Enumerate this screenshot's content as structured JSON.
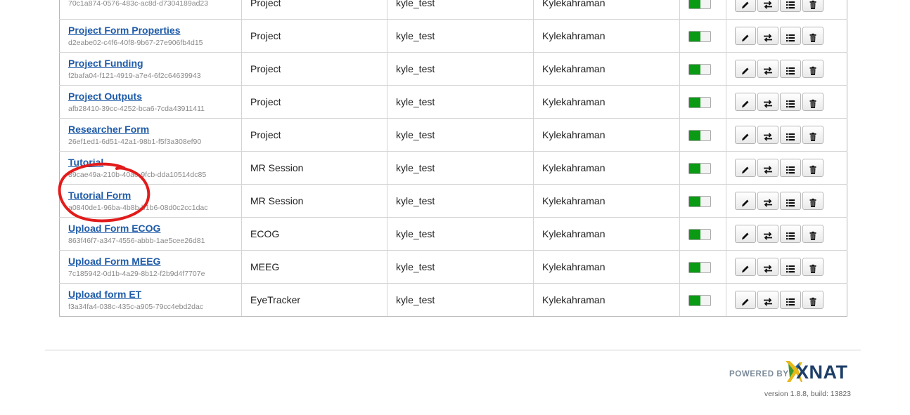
{
  "forms": [
    {
      "title": "",
      "id": "70c1a874-0576-483c-ac8d-d7304189ad23",
      "type": "Project",
      "user": "kyle_test",
      "owner": "Kylekahraman",
      "enabled": true
    },
    {
      "title": "Project Form Properties",
      "id": "d2eabe02-c4f6-40f8-9b67-27e906fb4d15",
      "type": "Project",
      "user": "kyle_test",
      "owner": "Kylekahraman",
      "enabled": true
    },
    {
      "title": "Project Funding",
      "id": "f2bafa04-f121-4919-a7e4-6f2c64639943",
      "type": "Project",
      "user": "kyle_test",
      "owner": "Kylekahraman",
      "enabled": true
    },
    {
      "title": "Project Outputs",
      "id": "afb28410-39cc-4252-bca6-7cda43911411",
      "type": "Project",
      "user": "kyle_test",
      "owner": "Kylekahraman",
      "enabled": true
    },
    {
      "title": "Researcher Form",
      "id": "26ef1ed1-6d51-42a1-98b1-f5f3a308ef90",
      "type": "Project",
      "user": "kyle_test",
      "owner": "Kylekahraman",
      "enabled": true
    },
    {
      "title": "Tutorial",
      "id": "89cae49a-210b-40a0-9fcb-dda10514dc85",
      "type": "MR Session",
      "user": "kyle_test",
      "owner": "Kylekahraman",
      "enabled": true
    },
    {
      "title": "Tutorial Form",
      "id": "a0840de1-96ba-4b8b-b1b6-08d0c2cc1dac",
      "type": "MR Session",
      "user": "kyle_test",
      "owner": "Kylekahraman",
      "enabled": true
    },
    {
      "title": "Upload Form ECOG",
      "id": "863f46f7-a347-4556-abbb-1ae5cee26d81",
      "type": "ECOG",
      "user": "kyle_test",
      "owner": "Kylekahraman",
      "enabled": true
    },
    {
      "title": "Upload Form MEEG",
      "id": "7c185942-0d1b-4a29-8b12-f2b9d4f7707e",
      "type": "MEEG",
      "user": "kyle_test",
      "owner": "Kylekahraman",
      "enabled": true
    },
    {
      "title": "Upload form ET",
      "id": "f3a34fa4-038c-435c-a905-79cc4ebd2dac",
      "type": "EyeTracker",
      "user": "kyle_test",
      "owner": "Kylekahraman",
      "enabled": true
    }
  ],
  "actions": [
    "pencil-icon",
    "swap-arrows-icon",
    "list-icon",
    "trash-icon"
  ],
  "colors": {
    "link": "#1f5ba8",
    "toggle_on": "#0a9a14",
    "annotation": "#e21b1b",
    "xnat_navy": "#1d3e66"
  },
  "footer": {
    "powered_by": "POWERED BY",
    "brand": "XNAT",
    "version": "version 1.8.8, build: 13823"
  }
}
